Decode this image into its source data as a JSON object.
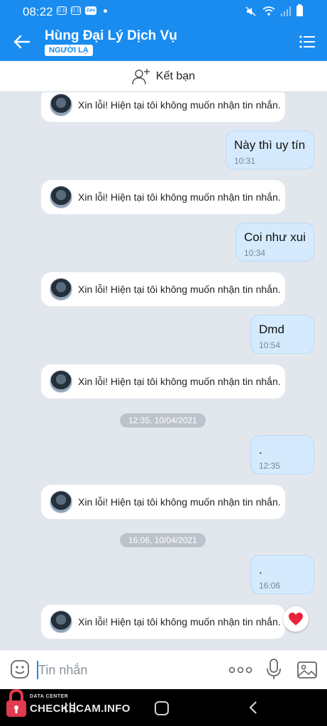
{
  "status_bar": {
    "time": "08:22",
    "zalo_icon": "Zalo"
  },
  "header": {
    "contact_name": "Hùng Đại Lý Dịch Vụ",
    "badge": "NGƯỜI LẠ",
    "back_icon": "arrow-left-icon",
    "menu_icon": "list-menu-icon"
  },
  "friend_bar": {
    "label": "Kết bạn",
    "icon": "add-person-icon"
  },
  "messages": [
    {
      "type": "auto",
      "text": "Xin lỗi! Hiện tại tôi không muốn nhận tin nhắn."
    },
    {
      "type": "mine",
      "text": "Này thì uy tín",
      "time": "10:31"
    },
    {
      "type": "auto",
      "text": "Xin lỗi! Hiện tại tôi không muốn nhận tin nhắn."
    },
    {
      "type": "mine",
      "text": "Coi như xui",
      "time": "10:34"
    },
    {
      "type": "auto",
      "text": "Xin lỗi! Hiện tại tôi không muốn nhận tin nhắn."
    },
    {
      "type": "mine",
      "text": "Dmd",
      "time": "10:54"
    },
    {
      "type": "auto",
      "text": "Xin lỗi! Hiện tại tôi không muốn nhận tin nhắn."
    },
    {
      "type": "date",
      "text": "12:35, 10/04/2021"
    },
    {
      "type": "mine",
      "text": ".",
      "time": "12:35"
    },
    {
      "type": "auto",
      "text": "Xin lỗi! Hiện tại tôi không muốn nhận tin nhắn."
    },
    {
      "type": "date",
      "text": "16:06, 10/04/2021"
    },
    {
      "type": "mine",
      "text": ".",
      "time": "16:06"
    },
    {
      "type": "auto",
      "text": "Xin lỗi! Hiện tại tôi không muốn nhận tin nhắn.",
      "reaction": "heart"
    }
  ],
  "input_bar": {
    "placeholder": "Tin nhắn"
  },
  "watermark": {
    "sub": "DATA CENTER",
    "main": "CHECKSCAM.INFO"
  },
  "colors": {
    "brand": "#1a8cf0",
    "my_bubble": "#d5ebfd",
    "chat_bg": "#e2e7ee",
    "heart": "#e8233a"
  }
}
